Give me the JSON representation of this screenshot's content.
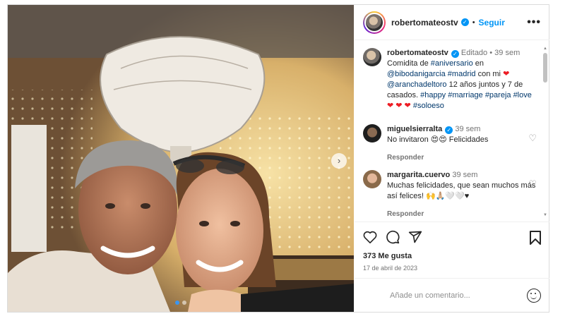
{
  "post": {
    "username": "robertomateostv",
    "follow_label": "Seguir",
    "separator": "•",
    "more_label": "•••"
  },
  "caption": {
    "username": "robertomateostv",
    "edited": "Editado",
    "separator": "•",
    "time": "39 sem",
    "line1": "Comidita de ",
    "tag_aniversario": "#aniversario",
    "line1b": " en",
    "mention_venue": "@bibodanigarcia",
    "tag_madrid": "#madrid",
    "con_mi": " con mi ",
    "heart": "❤",
    "mention_wife": "@aranchadeltoro",
    "years_text": " 12 años juntos y 7 de casados. ",
    "tags_end": "#happy #marriage #pareja #love",
    "hearts": "❤ ❤ ❤",
    "tag_solo": "#soloeso"
  },
  "comments": [
    {
      "username": "miguelsierralta",
      "time": "39 sem",
      "text": "No invitaron 😍😍 Felicidades",
      "reply_label": "Responder",
      "like_icon": "♡"
    },
    {
      "username": "margarita.cuervo",
      "time": "39 sem",
      "text": "Muchas felicidades, que sean muchos más así felices! 🙌🙏🏼🤍🤍♥",
      "reply_label": "Responder",
      "like_icon": "♡"
    }
  ],
  "stats": {
    "likes": "373 Me gusta",
    "date": "17 de abril de 2023"
  },
  "add_comment": {
    "placeholder": "Añade un comentario..."
  },
  "photo": {
    "next_arrow": "›"
  },
  "colors": {
    "accent": "#0095f6",
    "heart": "#ed1c24"
  }
}
